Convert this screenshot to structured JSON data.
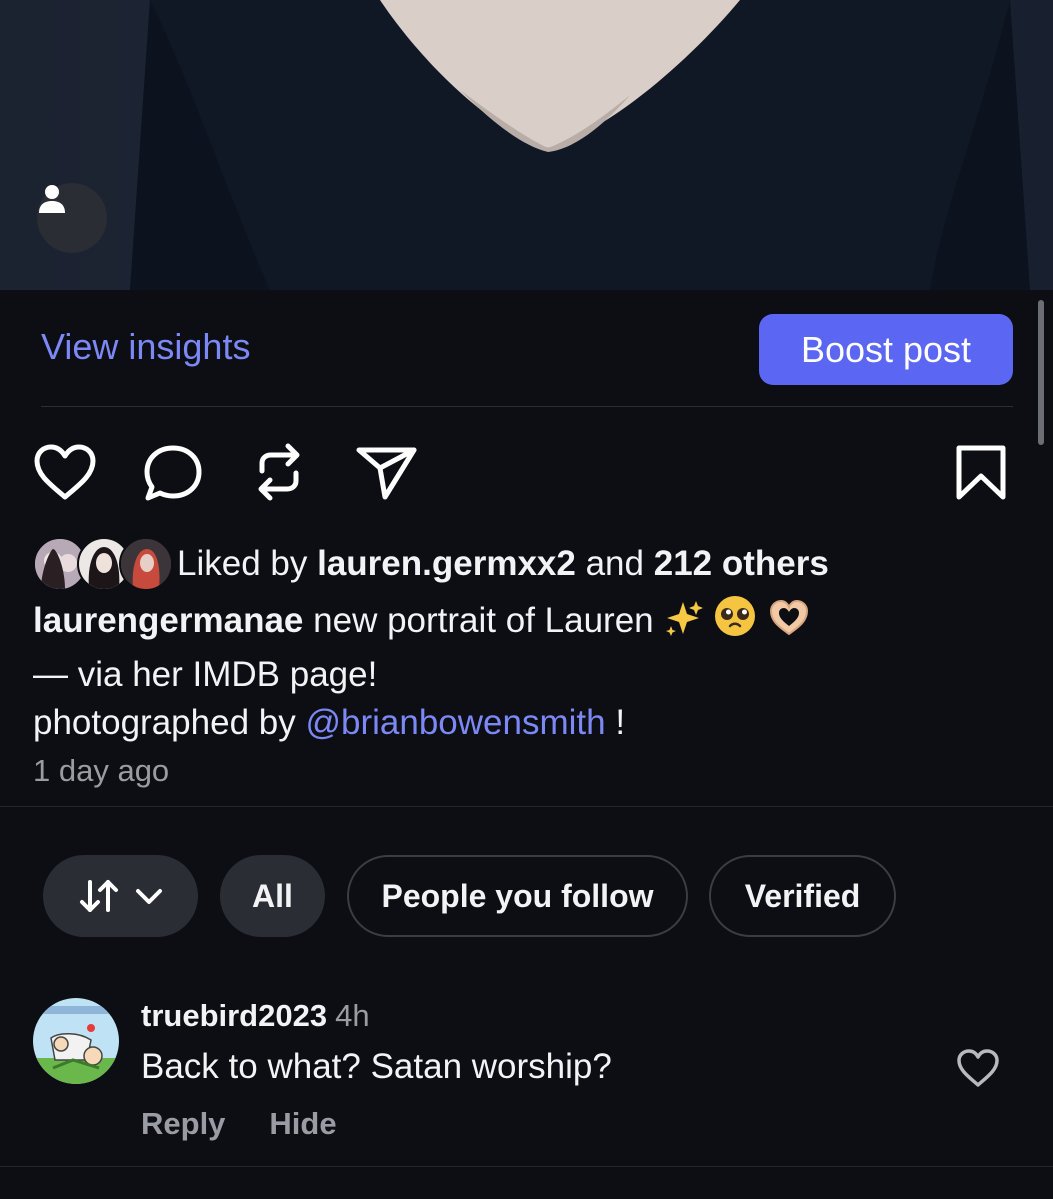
{
  "post": {
    "view_insights_label": "View insights",
    "boost_label": "Boost post"
  },
  "likes": {
    "prefix": "Liked by",
    "user": "lauren.germxx2",
    "middle": "and",
    "others": "212 others"
  },
  "caption": {
    "username": "laurengermanae",
    "line1": "new portrait of Lauren",
    "emojis": [
      "sparkles",
      "pleading-face",
      "heart-hands"
    ],
    "line2": "— via her IMDB page!",
    "line3_prefix": "photographed by",
    "mention": "@brianbowensmith",
    "line3_suffix": "!"
  },
  "timestamp": "1 day ago",
  "filters": {
    "sort_icon": "sort-arrows-icon",
    "chips": [
      "All",
      "People you follow",
      "Verified"
    ]
  },
  "comment": {
    "username": "truebird2023",
    "time": "4h",
    "text": "Back to what?  Satan worship?",
    "reply_label": "Reply",
    "hide_label": "Hide"
  },
  "colors": {
    "background": "#0c0e13",
    "accent": "#5b66f2",
    "link": "#7c88f5"
  }
}
